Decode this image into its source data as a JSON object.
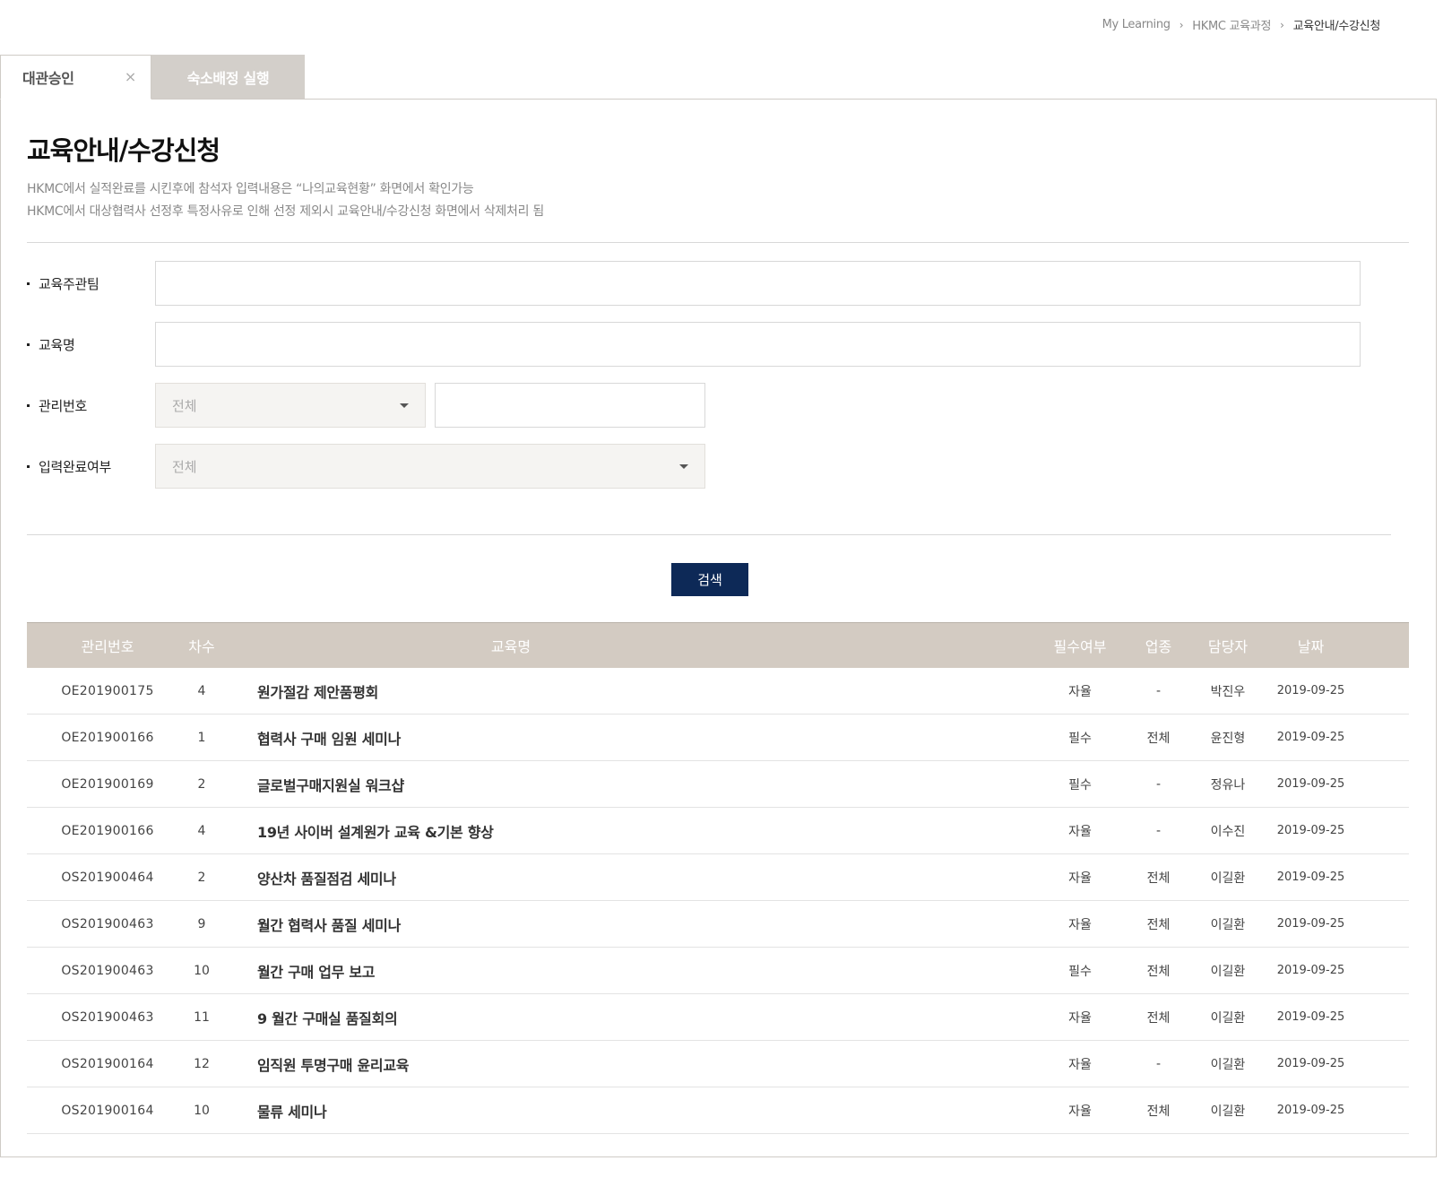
{
  "breadcrumb": {
    "items": [
      "My Learning",
      "HKMC 교육과정",
      "교육안내/수강신청"
    ],
    "separator": "›"
  },
  "tabs": [
    {
      "label": "대관승인",
      "active": true,
      "close_icon": "×"
    },
    {
      "label": "숙소배정 실행",
      "active": false
    }
  ],
  "page": {
    "title": "교육안내/수강신청",
    "desc_line1": "HKMC에서 실적완료를 시킨후에 참석자 입력내용은 “나의교육현황” 화면에서 확인가능",
    "desc_line2": "HKMC에서 대상협력사 선정후 특정사유로 인해 선정 제외시 교육안내/수강신청 화면에서 삭제처리 됨"
  },
  "filters": {
    "dept_label": "교육주관팀",
    "dept_value": "",
    "name_label": "교육명",
    "name_value": "",
    "mgmt_label": "관리번호",
    "mgmt_select": "전체",
    "mgmt_value": "",
    "done_label": "입력완료여부",
    "done_select": "전체"
  },
  "search_button": "검색",
  "table": {
    "headers": [
      "관리번호",
      "차수",
      "교육명",
      "필수여부",
      "업종",
      "담당자",
      "날짜"
    ],
    "rows": [
      [
        "OE201900175",
        "4",
        "원가절감 제안품평회",
        "자율",
        "-",
        "박진우",
        "2019-09-25"
      ],
      [
        "OE201900166",
        "1",
        "협력사 구매 임원 세미나",
        "필수",
        "전체",
        "윤진형",
        "2019-09-25"
      ],
      [
        "OE201900169",
        "2",
        "글로벌구매지원실 워크샵",
        "필수",
        "-",
        "정유나",
        "2019-09-25"
      ],
      [
        "OE201900166",
        "4",
        "19년 사이버 설계원가 교육 &기본 향상",
        "자율",
        "-",
        "이수진",
        "2019-09-25"
      ],
      [
        "OS201900464",
        "2",
        "양산차 품질점검 세미나",
        "자율",
        "전체",
        "이길환",
        "2019-09-25"
      ],
      [
        "OS201900463",
        "9",
        "월간 협력사 품질 세미나",
        "자율",
        "전체",
        "이길환",
        "2019-09-25"
      ],
      [
        "OS201900463",
        "10",
        "월간 구매 업무 보고",
        "필수",
        "전체",
        "이길환",
        "2019-09-25"
      ],
      [
        "OS201900463",
        "11",
        "9  월간 구매실 품질회의",
        "자율",
        "전체",
        "이길환",
        "2019-09-25"
      ],
      [
        "OS201900164",
        "12",
        "임직원 투명구매 윤리교육",
        "자율",
        "-",
        "이길환",
        "2019-09-25"
      ],
      [
        "OS201900164",
        "10",
        "물류 세미나",
        "자율",
        "전체",
        "이길환",
        "2019-09-25"
      ]
    ]
  },
  "colors": {
    "accent": "#0d2957",
    "table_header": "#d3cbc2",
    "inactive_tab": "#d3cfca"
  }
}
